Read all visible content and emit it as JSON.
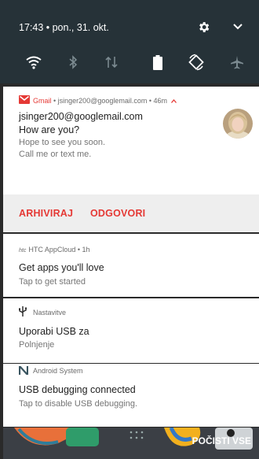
{
  "status_bar": {
    "text": "17:43 • pon., 31. okt.",
    "icons": [
      "gear-icon",
      "chevron-down-icon"
    ]
  },
  "quick_settings": [
    "wifi-icon",
    "bluetooth-icon",
    "data-transfer-icon",
    "battery-icon",
    "auto-rotate-icon",
    "airplane-mode-icon"
  ],
  "gmail_notification": {
    "app": "Gmail",
    "header_rest": " • jsinger200@googlemail.com • 46m",
    "sender": "jsinger200@googlemail.com",
    "subject": "How are you?",
    "body_line1": "Hope to see you soon.",
    "body_line2": "Call me or text me.",
    "actions": [
      "ARHIVIRAJ",
      "ODGOVORI"
    ]
  },
  "htc_notification": {
    "header": "HTC AppCloud • 1h",
    "logo": "htc",
    "title": "Get apps you'll love",
    "text": "Tap to get started"
  },
  "usb_notification": {
    "header": "Nastavitve",
    "title": "Uporabi USB za",
    "text": "Polnjenje"
  },
  "debug_notification": {
    "header": "Android System",
    "title": "USB debugging connected",
    "text": "Tap to disable USB debugging."
  },
  "dismiss_all_label": "POČISTI VSE",
  "colors": {
    "shade": "#263238",
    "accent": "#e53935",
    "card": "#ffffff",
    "actions_bg": "#eeeeee"
  }
}
